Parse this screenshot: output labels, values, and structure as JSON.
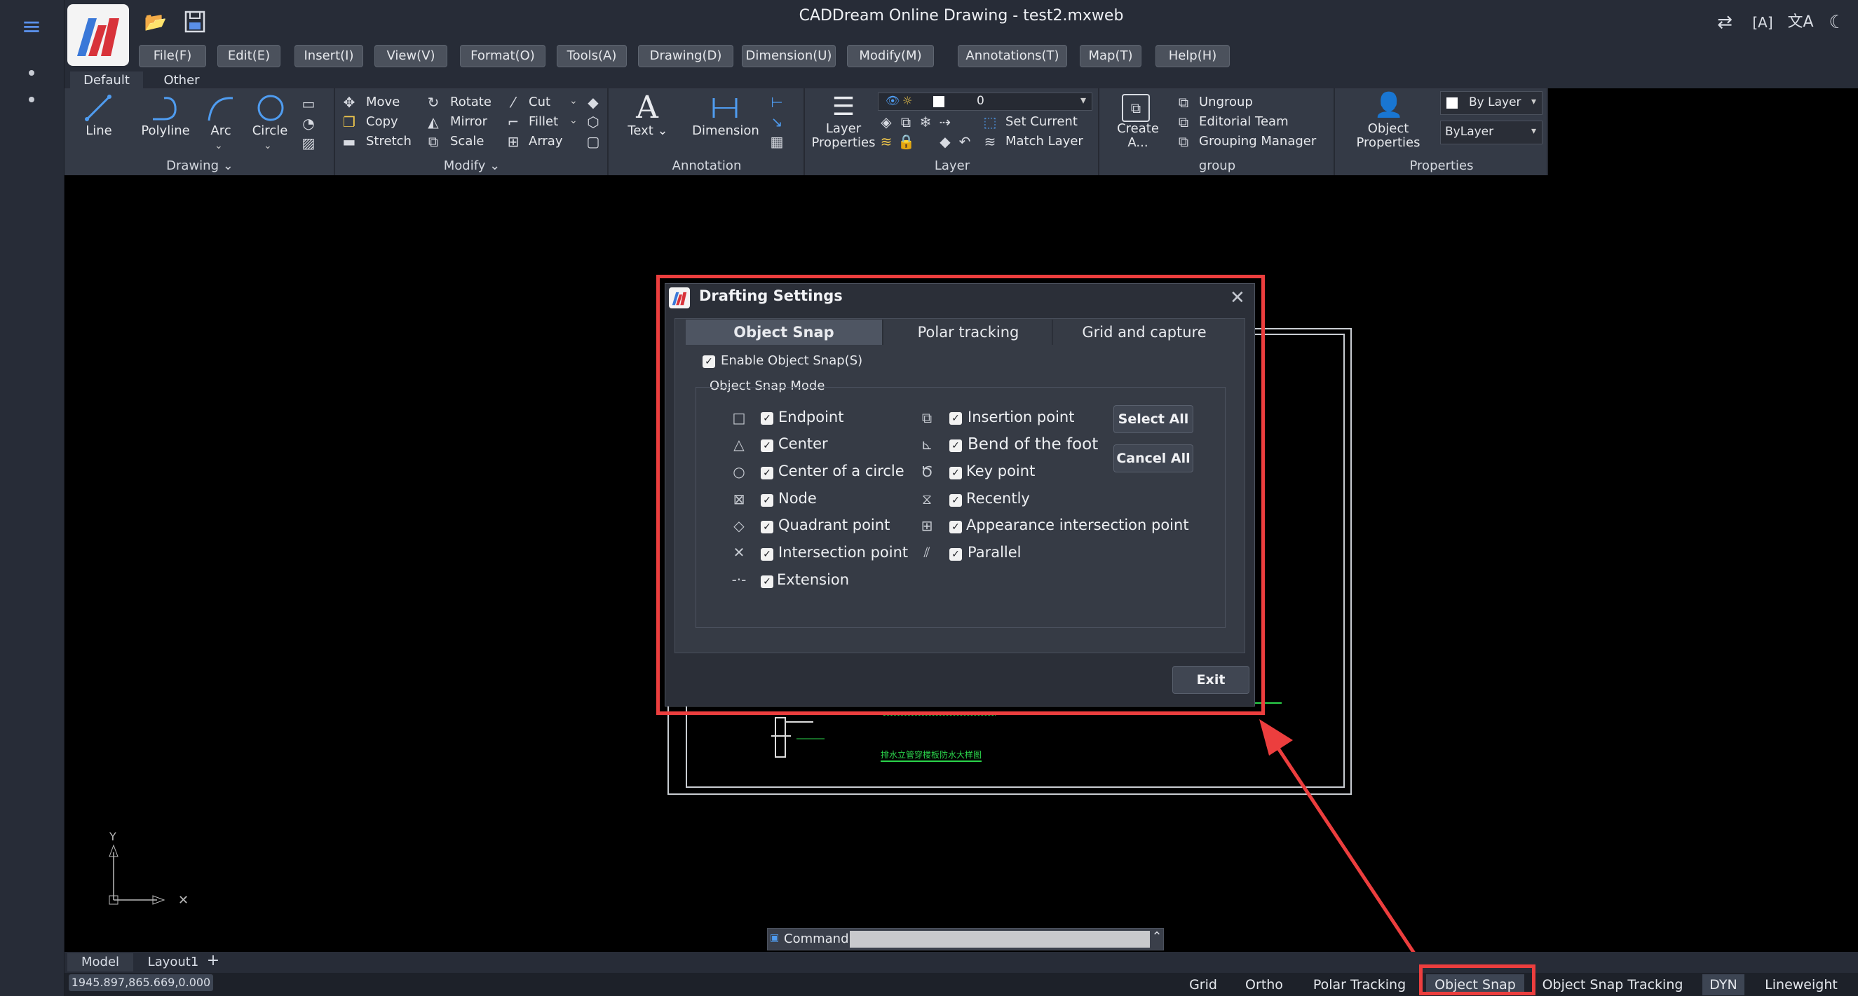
{
  "app": {
    "title": "CADDream Online Drawing - test2.mxweb"
  },
  "menu": [
    "File(F)",
    "Edit(E)",
    "Insert(I)",
    "View(V)",
    "Format(O)",
    "Tools(A)",
    "Drawing(D)",
    "Dimension(U)",
    "Modify(M)",
    "Annotations(T)",
    "Map(T)",
    "Help(H)"
  ],
  "ribbon_tabs": [
    "Default",
    "Other"
  ],
  "ribbon": {
    "drawing": {
      "label": "Drawing ⌄",
      "line": "Line",
      "polyline": "Polyline",
      "arc": "Arc",
      "circle": "Circle"
    },
    "modify": {
      "label": "Modify ⌄",
      "move": "Move",
      "copy": "Copy",
      "stretch": "Stretch",
      "rotate": "Rotate",
      "mirror": "Mirror",
      "scale": "Scale",
      "cut": "Cut",
      "fillet": "Fillet",
      "array": "Array"
    },
    "annotation": {
      "label": "Annotation",
      "text": "Text ⌄",
      "dimension": "Dimension"
    },
    "layer": {
      "label": "Layer",
      "layer_properties": "Layer Properties",
      "current_layer": "0",
      "set_current": "Set Current",
      "match_layer": "Match Layer"
    },
    "group": {
      "label": "group",
      "create": "Create A...",
      "ungroup": "Ungroup",
      "editorial_team": "Editorial Team",
      "grouping_manager": "Grouping Manager"
    },
    "properties": {
      "label": "Properties",
      "object_properties": "Object Properties",
      "color": "By Layer",
      "linetype": "ByLayer"
    }
  },
  "dialog": {
    "title": "Drafting Settings",
    "tabs": [
      "Object Snap",
      "Polar tracking",
      "Grid and capture"
    ],
    "enable_label": "Enable Object Snap(S)",
    "enable_checked": true,
    "mode_label": "Object Snap Mode",
    "left_options": [
      {
        "label": "Endpoint",
        "icon": "square-icon",
        "checked": true
      },
      {
        "label": "Center",
        "icon": "triangle-icon",
        "checked": true
      },
      {
        "label": "Center of a circle",
        "icon": "circle-icon",
        "checked": true
      },
      {
        "label": "Node",
        "icon": "node-icon",
        "checked": true
      },
      {
        "label": "Quadrant point",
        "icon": "diamond-icon",
        "checked": true
      },
      {
        "label": "Intersection point",
        "icon": "cross-icon",
        "checked": true
      },
      {
        "label": "Extension",
        "icon": "extension-icon",
        "checked": true
      }
    ],
    "right_options": [
      {
        "label": "Insertion point",
        "icon": "insertion-icon",
        "checked": true
      },
      {
        "label": "Bend of the foot",
        "icon": "perpendicular-icon",
        "checked": true
      },
      {
        "label": "Key point",
        "icon": "tangent-icon",
        "checked": true
      },
      {
        "label": "Recently",
        "icon": "nearest-icon",
        "checked": true
      },
      {
        "label": "Appearance intersection point",
        "icon": "apparent-intersection-icon",
        "checked": true
      },
      {
        "label": "Parallel",
        "icon": "parallel-icon",
        "checked": true
      }
    ],
    "select_all": "Select All",
    "cancel_all": "Cancel All",
    "exit": "Exit"
  },
  "layout_tabs": [
    "Model",
    "Layout1",
    "+"
  ],
  "coordinates": "1945.897,865.669,0.000",
  "command": {
    "label": "Command:",
    "value": ""
  },
  "status": {
    "items": [
      "Grid",
      "Ortho",
      "Polar Tracking",
      "Object Snap",
      "Object Snap Tracking",
      "DYN",
      "Lineweight"
    ]
  },
  "drawing_text": {
    "green_line": "排水立管穿楼板防水大样图",
    "axis_y": "Y"
  },
  "colors": {
    "accent": "#4f9cf0",
    "highlight": "#ec3e3e",
    "cad_green": "#2bd44b"
  }
}
